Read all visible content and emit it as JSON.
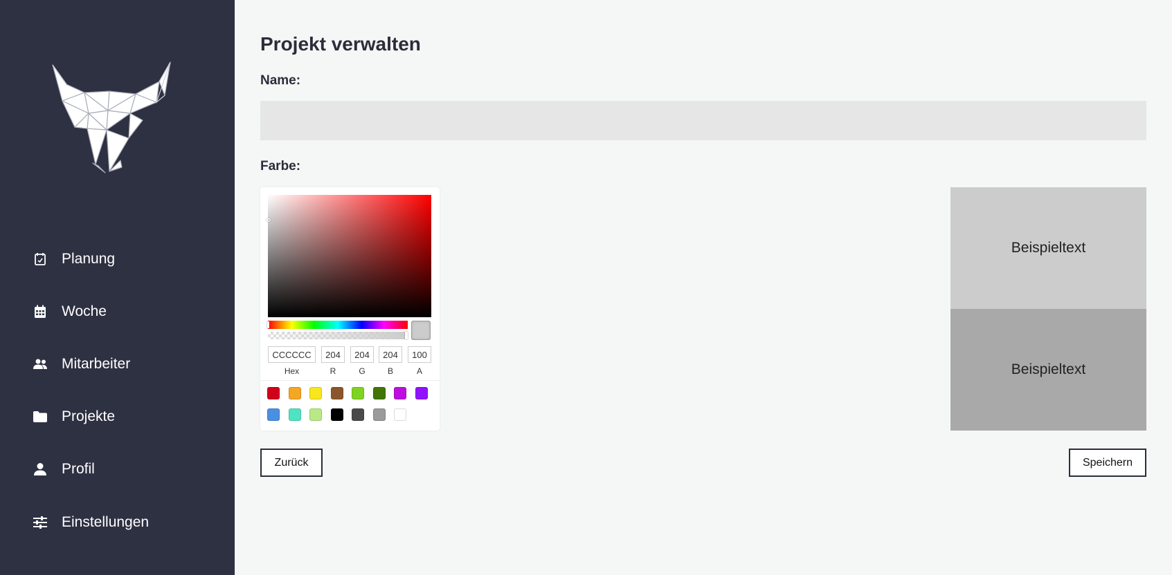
{
  "sidebar": {
    "items": [
      {
        "label": "Planung",
        "icon": "calendar-check-icon"
      },
      {
        "label": "Woche",
        "icon": "calendar-grid-icon"
      },
      {
        "label": "Mitarbeiter",
        "icon": "people-icon"
      },
      {
        "label": "Projekte",
        "icon": "folder-icon"
      },
      {
        "label": "Profil",
        "icon": "person-icon"
      },
      {
        "label": "Einstellungen",
        "icon": "sliders-icon"
      }
    ]
  },
  "page": {
    "title": "Projekt verwalten",
    "name_label": "Name:",
    "name_value": "",
    "color_label": "Farbe:"
  },
  "picker": {
    "hex": "CCCCCC",
    "r": "204",
    "g": "204",
    "b": "204",
    "a": "100",
    "labels": {
      "hex": "Hex",
      "r": "R",
      "g": "G",
      "b": "B",
      "a": "A"
    },
    "current_color": "#cccccc",
    "presets": [
      "#d0021b",
      "#f5a623",
      "#f8e71c",
      "#8b572a",
      "#7ed321",
      "#417505",
      "#bd10e0",
      "#9013fe",
      "#4a90e2",
      "#50e3c2",
      "#b8e986",
      "#000000",
      "#4a4a4a",
      "#9b9b9b",
      "#ffffff"
    ]
  },
  "preview": {
    "text_light": "Beispieltext",
    "text_dark": "Beispieltext",
    "color_light": "#cccccc",
    "color_dark": "#a9a9a9"
  },
  "buttons": {
    "back": "Zurück",
    "save": "Speichern"
  }
}
